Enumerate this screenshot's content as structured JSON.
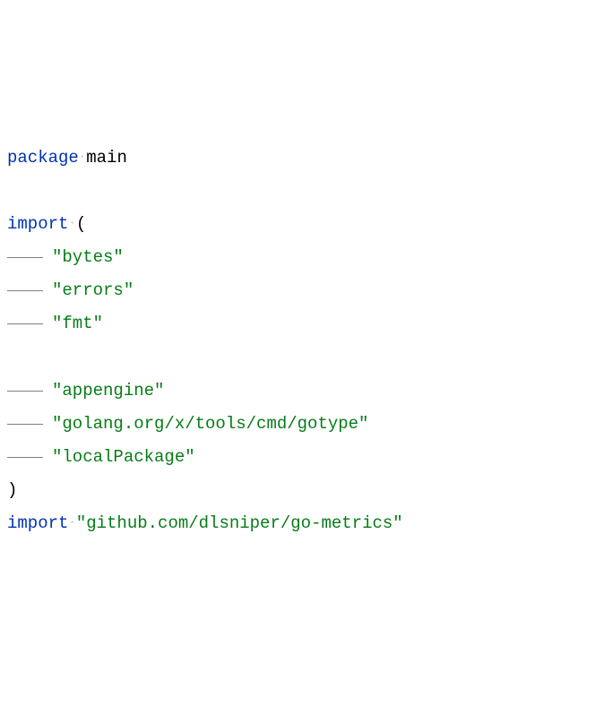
{
  "code": {
    "line1": {
      "keyword": "package",
      "identifier": "main"
    },
    "line2": {
      "keyword": "import",
      "paren": "("
    },
    "imports_block1": [
      "\"bytes\"",
      "\"errors\"",
      "\"fmt\""
    ],
    "imports_block2": [
      "\"appengine\"",
      "\"golang.org/x/tools/cmd/gotype\"",
      "\"localPackage\""
    ],
    "close_paren": ")",
    "line_last": {
      "keyword": "import",
      "string": "\"github.com/dlsniper/go-metrics\""
    }
  }
}
